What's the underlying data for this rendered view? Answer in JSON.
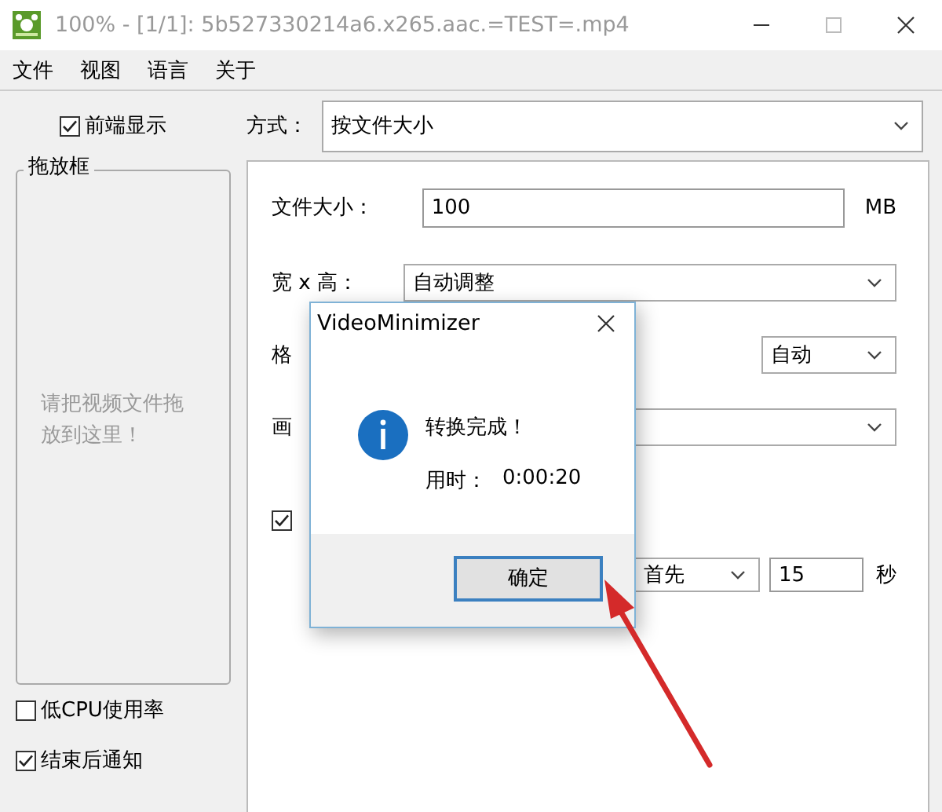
{
  "window": {
    "title": "100% - [1/1]: 5b527330214a6.x265.aac.=TEST=.mp4"
  },
  "menu": [
    {
      "label": "文件"
    },
    {
      "label": "视图"
    },
    {
      "label": "语言"
    },
    {
      "label": "关于"
    }
  ],
  "left": {
    "always_on_top": {
      "label": "前端显示",
      "checked": true
    },
    "drop_box": {
      "title": "拖放框",
      "hint": "请把视频文件拖放到这里！"
    },
    "options": [
      {
        "label": "低CPU使用率",
        "checked": false
      },
      {
        "label": "结束后通知",
        "checked": true
      }
    ]
  },
  "mode": {
    "label": "方式：",
    "value": "按文件大小"
  },
  "settings": {
    "size_label": "文件大小：",
    "size_value": "100",
    "size_unit": "MB",
    "dims_label": "宽 x 高：",
    "dims_value": "自动调整",
    "format_label": "格",
    "format_value": "自动",
    "quality_label": "画",
    "option_checked": true,
    "priority_value": "首先",
    "seconds_value": "15",
    "seconds_unit": "秒"
  },
  "dialog": {
    "title": "VideoMinimizer",
    "message": "转换完成！",
    "time_label": "用时：",
    "time_value": "0:00:20",
    "button": "确定"
  }
}
